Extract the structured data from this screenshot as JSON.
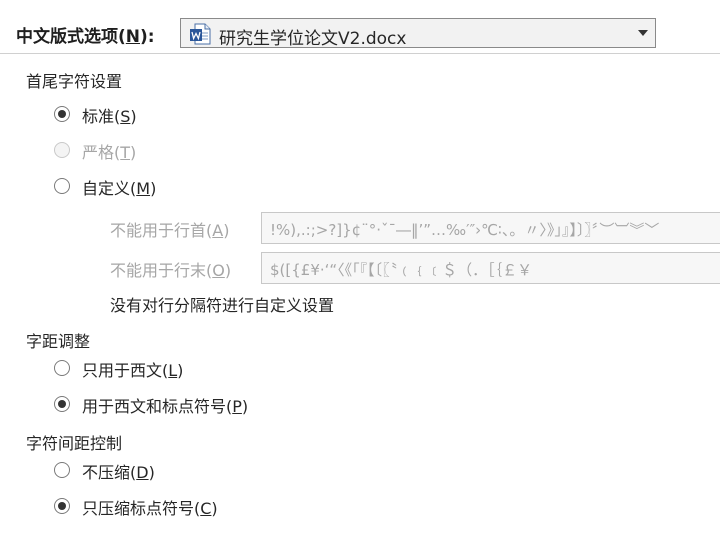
{
  "header": {
    "label_text": "中文版式选项(",
    "label_key": "N",
    "label_suffix": "):",
    "document_select": {
      "value": "研究生学位论文V2.docx",
      "icon": "word-document-icon"
    }
  },
  "line_break_rules": {
    "title": "首尾字符设置",
    "options": [
      {
        "text": "标准(",
        "key": "S",
        "suffix": ")",
        "checked": true,
        "disabled": false
      },
      {
        "text": "严格(",
        "key": "T",
        "suffix": ")",
        "checked": false,
        "disabled": true
      },
      {
        "text": "自定义(",
        "key": "M",
        "suffix": ")",
        "checked": false,
        "disabled": false
      }
    ],
    "not_at_line_start": {
      "label_text": "不能用于行首(",
      "label_key": "A",
      "label_suffix": ")",
      "value": "!%),.:;>?]}¢¨°·ˇˉ―‖’”…‰′″›℃∶、。〃〉》」』】〕〗〞︶︺︾﹀"
    },
    "not_at_line_end": {
      "label_text": "不能用于行末(",
      "label_key": "O",
      "label_suffix": ")",
      "value": "$([{£¥·‘“〈《「『【〔〖〝﹙﹛﹝＄（．［｛￡￥"
    },
    "note": "没有对行分隔符进行自定义设置"
  },
  "character_spacing": {
    "title": "字距调整",
    "options": [
      {
        "text": "只用于西文(",
        "key": "L",
        "suffix": ")",
        "checked": false
      },
      {
        "text": "用于西文和标点符号(",
        "key": "P",
        "suffix": ")",
        "checked": true
      }
    ]
  },
  "character_spacing_control": {
    "title": "字符间距控制",
    "options": [
      {
        "text": "不压缩(",
        "key": "D",
        "suffix": ")",
        "checked": false
      },
      {
        "text": "只压缩标点符号(",
        "key": "C",
        "suffix": ")",
        "checked": true
      }
    ]
  },
  "colors": {
    "text": "#262626",
    "disabled_text": "#a6a6a6",
    "word_blue": "#2b579a"
  }
}
